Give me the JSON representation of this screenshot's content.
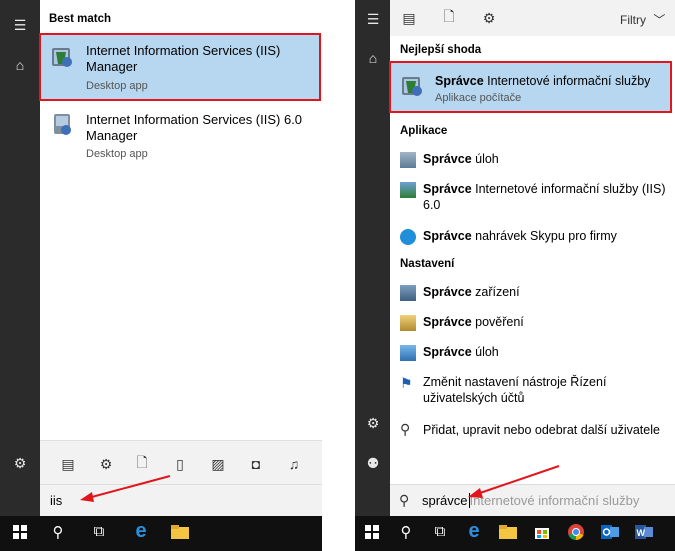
{
  "left": {
    "best_match_heading": "Best match",
    "results": [
      {
        "title": "Internet Information Services (IIS) Manager",
        "subtitle": "Desktop app"
      },
      {
        "title": "Internet Information Services (IIS) 6.0 Manager",
        "subtitle": "Desktop app"
      }
    ],
    "search_value": "iis"
  },
  "right": {
    "filters_label": "Filtry",
    "best_match_heading": "Nejlepší shoda",
    "best_match": {
      "bold": "Správce",
      "rest": " Internetové informační služby",
      "subtitle": "Aplikace počítače"
    },
    "apps_heading": "Aplikace",
    "apps": [
      {
        "bold": "Správce",
        "rest": " úloh",
        "icon": "task-manager-icon"
      },
      {
        "bold": "Správce",
        "rest": " Internetové informační služby (IIS) 6.0",
        "icon": "iis-icon"
      },
      {
        "bold": "Správce",
        "rest": " nahrávek Skypu pro firmy",
        "icon": "skype-icon"
      }
    ],
    "settings_heading": "Nastavení",
    "settings": [
      {
        "bold": "Správce",
        "rest": " zařízení",
        "icon": "device-manager-icon"
      },
      {
        "bold": "Správce",
        "rest": " pověření",
        "icon": "credential-manager-icon"
      },
      {
        "bold": "Správce",
        "rest": " úloh",
        "icon": "monitor-icon"
      },
      {
        "bold": "",
        "rest": "Změnit nastavení nástroje Řízení uživatelských účtů",
        "icon": "flag-icon"
      },
      {
        "bold": "",
        "rest": "Přidat, upravit nebo odebrat další uživatele",
        "icon": "user-icon"
      }
    ],
    "search_value": "správce",
    "search_suggestion": "Internetové informační služby"
  },
  "colors": {
    "highlight": "#b7d6ef",
    "annotation_red": "#e0161c",
    "rail": "#2b2b2b",
    "taskbar": "#101010"
  }
}
